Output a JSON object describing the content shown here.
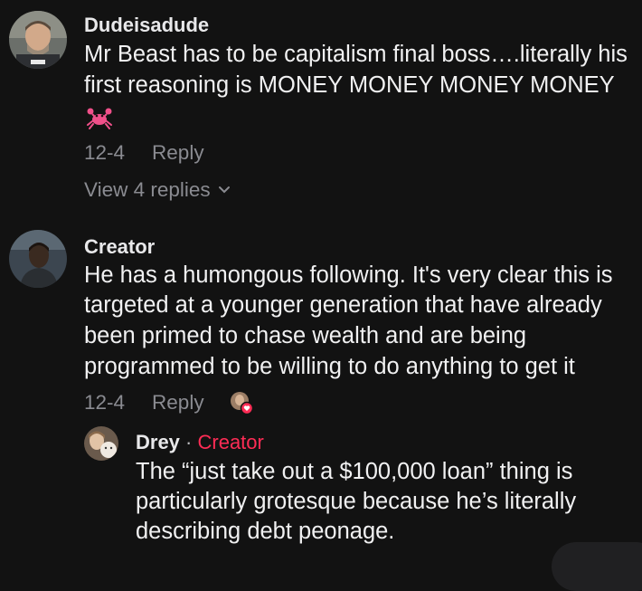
{
  "comments": [
    {
      "username": "Dudeisadude",
      "lines": [
        "Mr Beast has to be capitalism final boss….literally his",
        "first reasoning is MONEY MONEY MONEY MONEY"
      ],
      "emoji": "crab-icon",
      "date": "12-4",
      "reply_label": "Reply",
      "view_replies": "View 4 replies"
    },
    {
      "username": "Creator",
      "lines": [
        "He has a humongous following. It's very clear this is",
        "targeted at a younger generation that have already",
        "been primed to chase wealth and are being",
        "programmed to be willing to do anything to get it"
      ],
      "date": "12-4",
      "reply_label": "Reply",
      "liked_by_creator": true
    }
  ],
  "reply": {
    "username": "Drey",
    "separator": "·",
    "badge": "Creator",
    "lines": [
      "The “just take out a $100,000 loan” thing is",
      "particularly grotesque because he’s literally",
      "describing debt peonage."
    ]
  },
  "colors": {
    "background": "#121212",
    "text": "#f1f1f2",
    "muted": "#8a8b91",
    "accent": "#fe2c55"
  }
}
